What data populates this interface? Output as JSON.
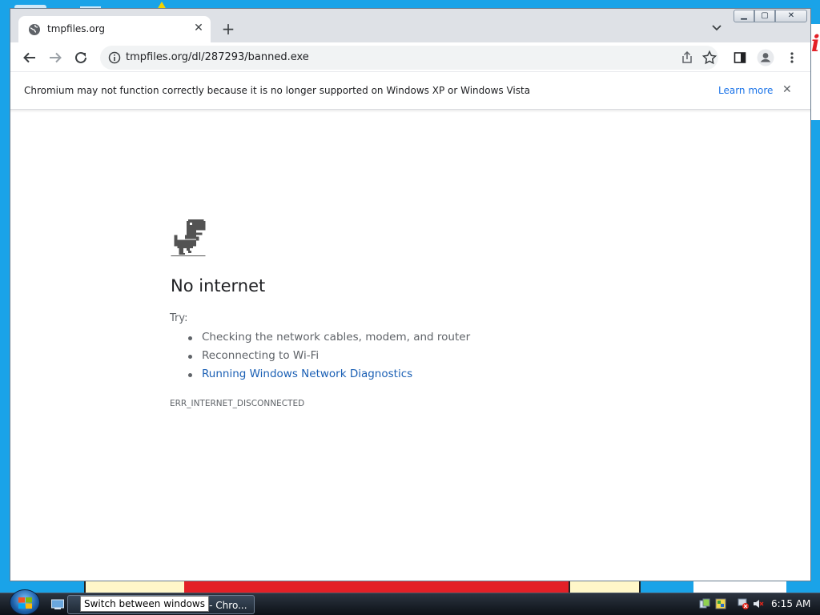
{
  "browser": {
    "tab": {
      "title": "tmpfiles.org",
      "close_glyph": "✕"
    },
    "newtab_glyph": "+",
    "tab_search_glyph": "⌄",
    "window_controls": {
      "minimize": "▁",
      "maximize": "▢",
      "close": "✕"
    },
    "omnibox": {
      "url": "tmpfiles.org/dl/287293/banned.exe"
    },
    "infobar": {
      "message": "Chromium may not function correctly because it is no longer supported on Windows XP or Windows Vista",
      "link": "Learn more",
      "close_glyph": "✕"
    }
  },
  "error_page": {
    "title": "No internet",
    "try_label": "Try:",
    "suggestions": [
      "Checking the network cables, modem, and router",
      "Reconnecting to Wi-Fi",
      "Running Windows Network Diagnostics"
    ],
    "error_code": "ERR_INTERNET_DISCONNECTED"
  },
  "taskbar": {
    "task_label": "rg - Chro...",
    "tooltip": "Switch between windows",
    "clock": "6:15 AM"
  },
  "wallpaper": {
    "right_fragment_text": "ia"
  },
  "colors": {
    "accent_link": "#1a73e8",
    "desktop": "#1aa3e8",
    "error_text": "#5f6368"
  },
  "icons": [
    "globe-icon",
    "back-icon",
    "forward-icon",
    "reload-icon",
    "info-icon",
    "share-icon",
    "star-icon",
    "side-panel-icon",
    "profile-icon",
    "menu-icon",
    "dino-icon",
    "windows-logo-icon"
  ]
}
